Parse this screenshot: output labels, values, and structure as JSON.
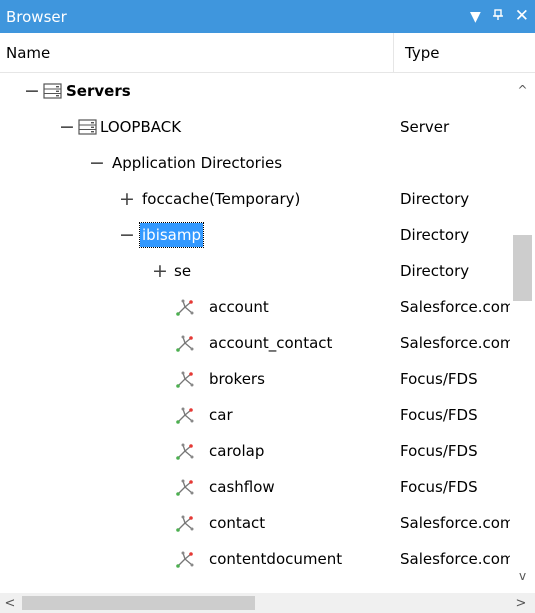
{
  "window": {
    "title": "Browser",
    "controls": {
      "dropdown": "▼",
      "pin": "ᵖ",
      "close": "✕"
    },
    "accent_color": "#3f96dd"
  },
  "columns": {
    "name": "Name",
    "type": "Type"
  },
  "tree": [
    {
      "expander": "−",
      "icon": "server-group-icon",
      "label": "Servers",
      "bold": true,
      "type": ""
    },
    {
      "expander": "−",
      "icon": "server-icon",
      "label": "LOOPBACK",
      "type": "Server"
    },
    {
      "expander": "−",
      "icon": "",
      "label": "Application Directories",
      "type": ""
    },
    {
      "expander": "+",
      "icon": "",
      "label": "foccache(Temporary)",
      "type": "Directory"
    },
    {
      "expander": "−",
      "icon": "",
      "label": "ibisamp",
      "selected": true,
      "type": "Directory"
    },
    {
      "expander": "+",
      "icon": "",
      "label": "se",
      "type": "Directory"
    },
    {
      "expander": "",
      "icon": "synonym-icon",
      "label": "account",
      "type": "Salesforce.com"
    },
    {
      "expander": "",
      "icon": "synonym-icon",
      "label": "account_contact",
      "type": "Salesforce.com"
    },
    {
      "expander": "",
      "icon": "synonym-icon",
      "label": "brokers",
      "type": "Focus/FDS"
    },
    {
      "expander": "",
      "icon": "synonym-icon",
      "label": "car",
      "type": "Focus/FDS"
    },
    {
      "expander": "",
      "icon": "synonym-icon",
      "label": "carolap",
      "type": "Focus/FDS"
    },
    {
      "expander": "",
      "icon": "synonym-icon",
      "label": "cashflow",
      "type": "Focus/FDS"
    },
    {
      "expander": "",
      "icon": "synonym-icon",
      "label": "contact",
      "type": "Salesforce.com"
    },
    {
      "expander": "",
      "icon": "synonym-icon",
      "label": "contentdocument",
      "type": "Salesforce.com"
    }
  ],
  "scrollbars": {
    "vertical": {
      "up": "^",
      "down": "v"
    },
    "horizontal": {
      "left": "<",
      "right": ">"
    }
  }
}
